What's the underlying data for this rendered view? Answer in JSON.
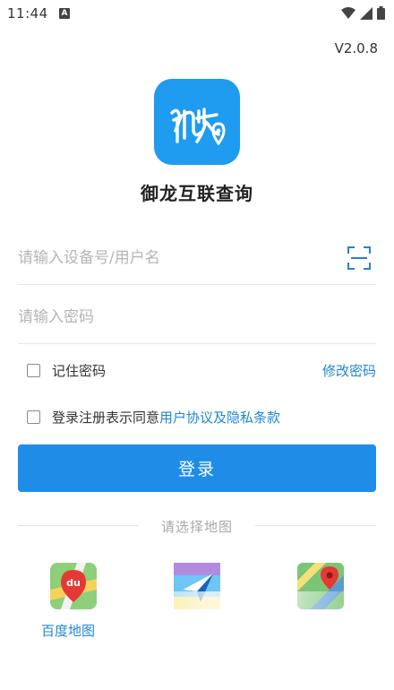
{
  "status_bar": {
    "time": "11:44",
    "notification_letter": "A"
  },
  "version": "V2.0.8",
  "app": {
    "name": "御龙互联查询",
    "brand_color": "#1f9bef"
  },
  "login_form": {
    "username_placeholder": "请输入设备号/用户名",
    "password_placeholder": "请输入密码",
    "remember_label": "记住密码",
    "modify_password_label": "修改密码",
    "agree_prefix": "登录注册表示同意",
    "agree_link": "用户协议及隐私条款",
    "login_button": "登录"
  },
  "map_select": {
    "title": "请选择地图",
    "maps": [
      {
        "label": "百度地图",
        "icon": "baidu-map-icon"
      },
      {
        "label": "",
        "icon": "gaode-map-icon"
      },
      {
        "label": "",
        "icon": "google-map-icon"
      }
    ]
  },
  "colors": {
    "accent": "#1f8de8",
    "link": "#1f86d6"
  }
}
